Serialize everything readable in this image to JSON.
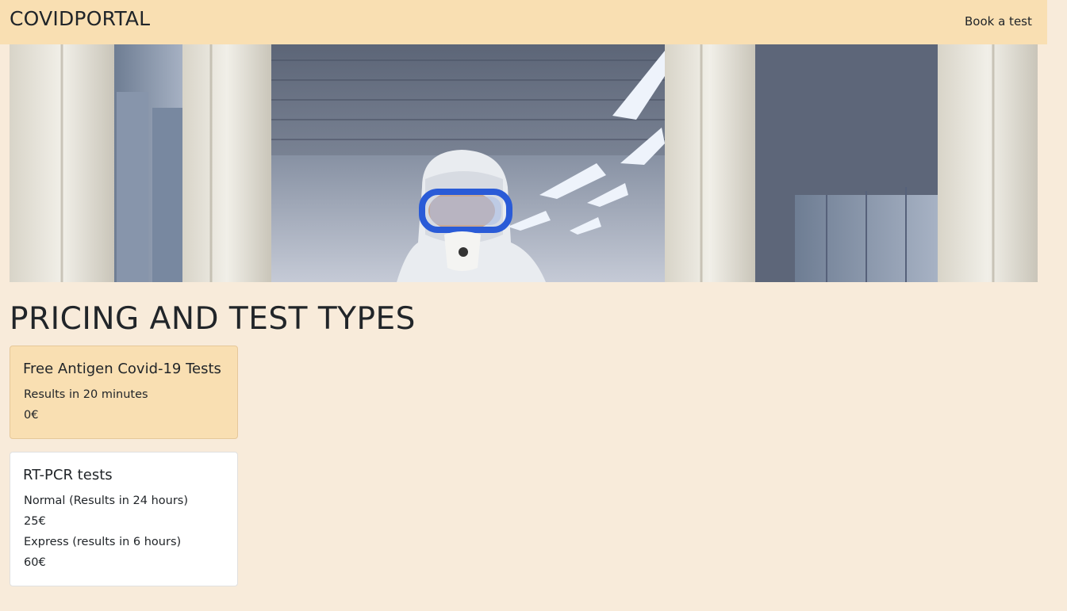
{
  "navbar": {
    "brand": "COVIDPORTAL",
    "link_label": "Book a test"
  },
  "hero": {
    "image": "person-in-protective-suit-photo"
  },
  "page_title": "PRICING AND TEST TYPES",
  "cards": [
    {
      "title": "Free Antigen Covid-19 Tests",
      "lines": [
        "Results in 20 minutes",
        "0€"
      ]
    },
    {
      "title": "RT-PCR tests",
      "lines": [
        "Normal (Results in 24 hours)",
        "25€",
        "Express (results in 6 hours)",
        "60€"
      ]
    }
  ],
  "colors": {
    "page_background": "#f8ebda",
    "navbar_background": "#f9dfb2",
    "highlight_card": "#f9dfb2",
    "text": "#212529"
  }
}
